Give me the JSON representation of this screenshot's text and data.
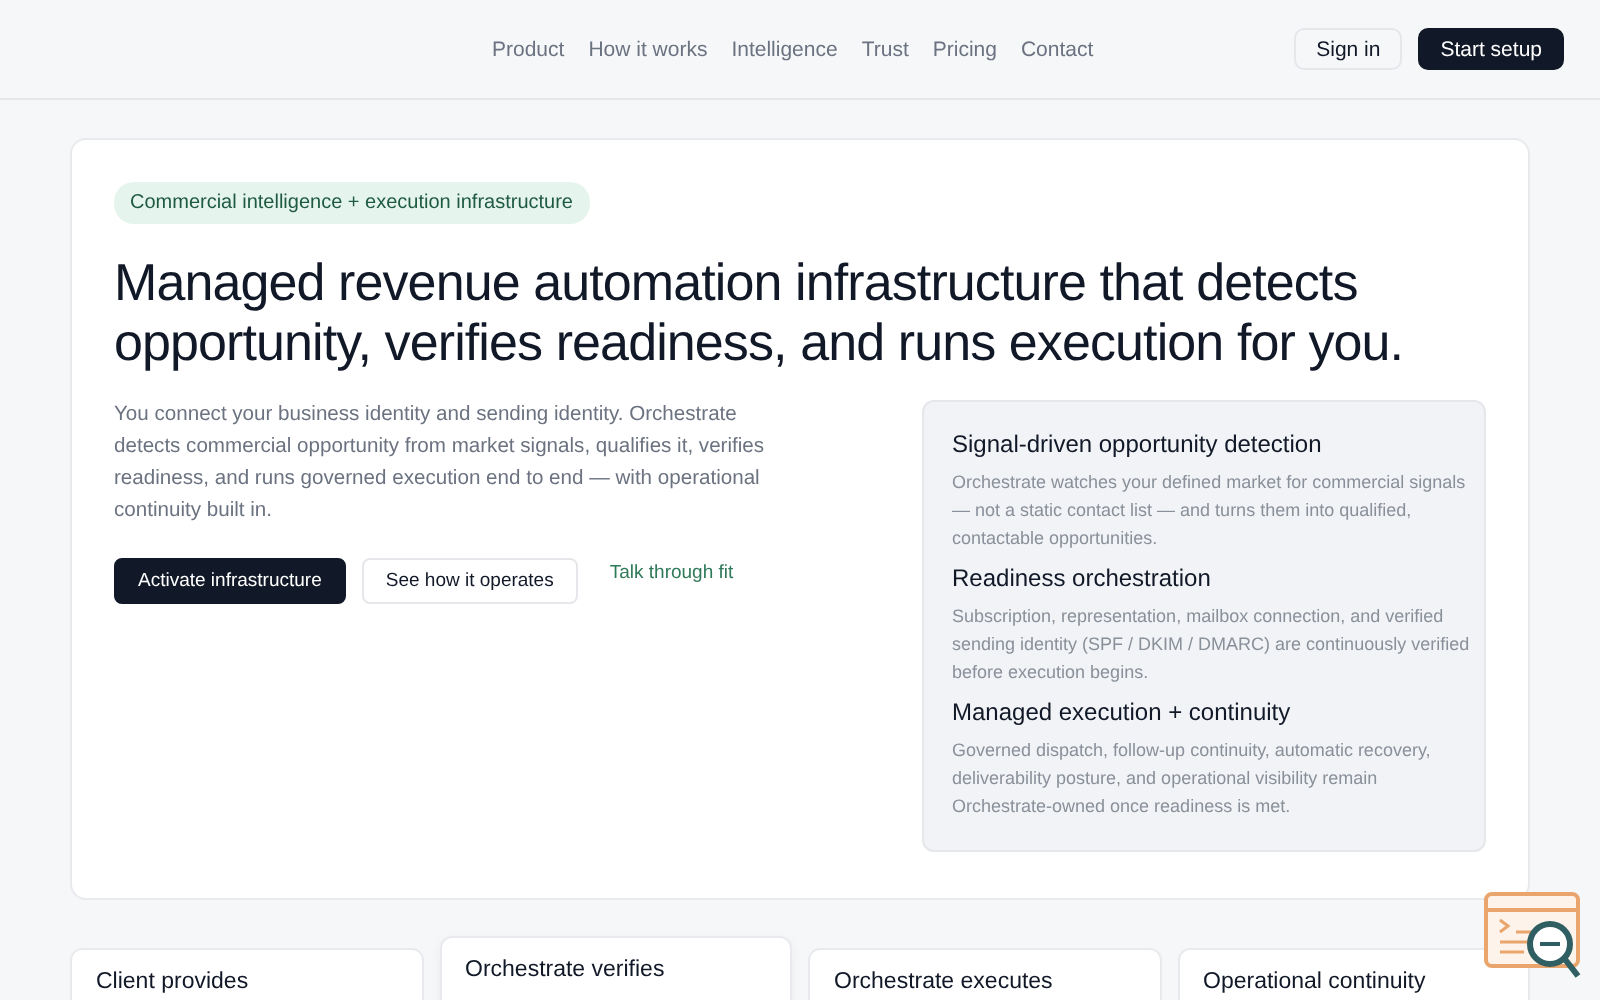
{
  "nav": {
    "links": [
      "Product",
      "How it works",
      "Intelligence",
      "Trust",
      "Pricing",
      "Contact"
    ],
    "sign_in": "Sign in",
    "start": "Start setup"
  },
  "hero": {
    "badge": "Commercial intelligence + execution infrastructure",
    "title": "Managed revenue automation infrastructure that detects opportunity, verifies readiness, and runs execution for you.",
    "intro": "You connect your business identity and sending identity. Orchestrate detects commercial opportunity from market signals, qualifies it, verifies readiness, and runs governed execution end to end — with operational continuity built in.",
    "actions": [
      {
        "kind": "primary",
        "label": "Activate infrastructure"
      },
      {
        "kind": "secondary",
        "label": "See how it operates"
      },
      {
        "kind": "link",
        "label": "Talk through fit"
      }
    ],
    "features": [
      {
        "title": "Signal-driven opportunity detection",
        "text": "Orchestrate watches your defined market for commercial signals — not a static contact list — and turns them into qualified, contactable opportunities."
      },
      {
        "title": "Readiness orchestration",
        "text": "Subscription, representation, mailbox connection, and verified sending identity (SPF / DKIM / DMARC) are continuously verified before execution begins."
      },
      {
        "title": "Managed execution + continuity",
        "text": "Governed dispatch, follow-up continuity, automatic recovery, deliverability posture, and operational visibility remain Orchestrate-owned once readiness is met."
      }
    ]
  },
  "steps": [
    {
      "title": "Client provides",
      "selected": false
    },
    {
      "title": "Orchestrate verifies",
      "selected": true
    },
    {
      "title": "Orchestrate executes",
      "selected": false
    },
    {
      "title": "Operational continuity",
      "selected": false
    }
  ]
}
